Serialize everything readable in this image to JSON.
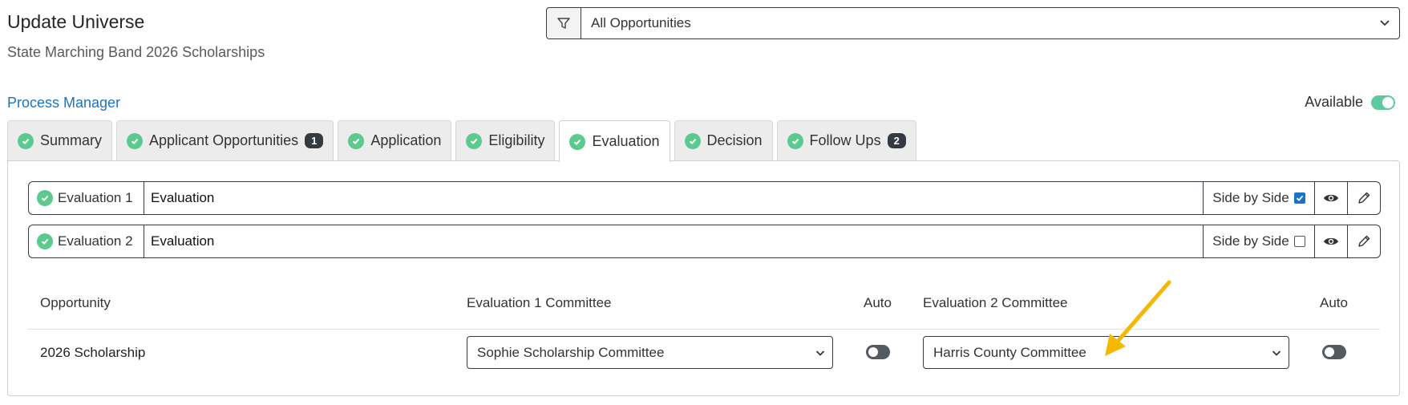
{
  "header": {
    "title": "Update Universe",
    "subtitle": "State Marching Band 2026 Scholarships"
  },
  "filter": {
    "icon": "filter-icon",
    "selected": "All Opportunities"
  },
  "process_manager": {
    "link": "Process Manager",
    "available_label": "Available",
    "available_on": true
  },
  "tabs": [
    {
      "label": "Summary",
      "badge": null,
      "active": false
    },
    {
      "label": "Applicant Opportunities",
      "badge": "1",
      "active": false
    },
    {
      "label": "Application",
      "badge": null,
      "active": false
    },
    {
      "label": "Eligibility",
      "badge": null,
      "active": false
    },
    {
      "label": "Evaluation",
      "badge": null,
      "active": true
    },
    {
      "label": "Decision",
      "badge": null,
      "active": false
    },
    {
      "label": "Follow Ups",
      "badge": "2",
      "active": false
    }
  ],
  "evaluations": [
    {
      "label": "Evaluation 1",
      "name": "Evaluation",
      "side_by_side_label": "Side by Side",
      "side_by_side": true
    },
    {
      "label": "Evaluation 2",
      "name": "Evaluation",
      "side_by_side_label": "Side by Side",
      "side_by_side": false
    }
  ],
  "table": {
    "headers": {
      "opportunity": "Opportunity",
      "eval1": "Evaluation 1 Committee",
      "auto1": "Auto",
      "eval2": "Evaluation 2 Committee",
      "auto2": "Auto"
    },
    "rows": [
      {
        "opportunity": "2026 Scholarship",
        "eval1_committee": "Sophie Scholarship Committee",
        "auto1": false,
        "eval2_committee": "Harris County Committee",
        "auto2": false
      }
    ]
  },
  "colors": {
    "accent_link": "#1a73c8",
    "success": "#5cc98e",
    "annotation_arrow": "#f5b800"
  }
}
